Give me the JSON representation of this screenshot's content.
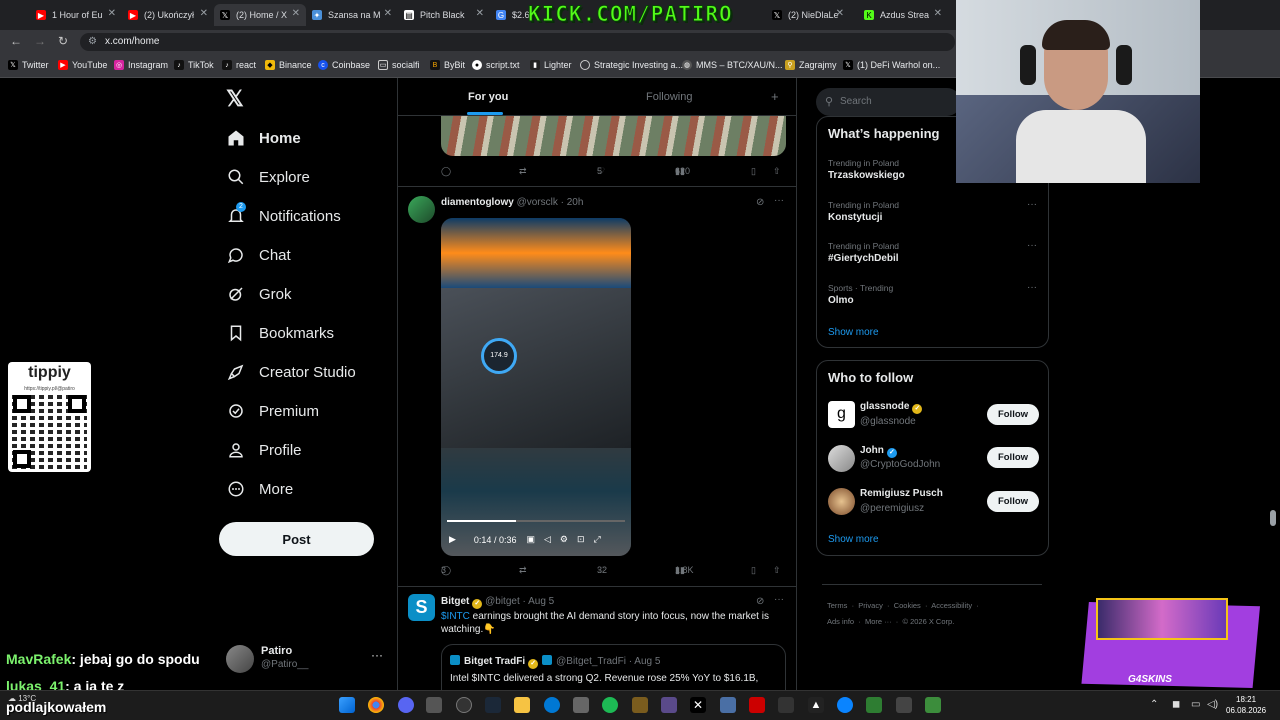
{
  "browser": {
    "tabs": [
      {
        "label": "1 Hour of Eu",
        "icon": "youtube-icon",
        "color": "#ff0000"
      },
      {
        "label": "(2) Ukończył",
        "icon": "youtube-icon",
        "color": "#ff0000"
      },
      {
        "label": "(2) Home / X",
        "icon": "x-icon",
        "color": "#000000"
      },
      {
        "label": "Szansa na M",
        "icon": "star-icon",
        "color": "#4a90d9"
      },
      {
        "label": "Pitch Black",
        "icon": "doc-icon",
        "color": "#ffffff"
      },
      {
        "label": "$2.6",
        "icon": "google-icon",
        "color": "#4285f4"
      },
      {
        "label": "(2) NieDlaLe",
        "icon": "x-icon",
        "color": "#000000"
      },
      {
        "label": "Azdus Strea",
        "icon": "kick-icon",
        "color": "#53fc18"
      }
    ],
    "url": "x.com/home",
    "bookmarks": [
      {
        "label": "Twitter",
        "icon": "x-icon"
      },
      {
        "label": "YouTube",
        "icon": "youtube-icon"
      },
      {
        "label": "Instagram",
        "icon": "instagram-icon"
      },
      {
        "label": "TikTok",
        "icon": "tiktok-icon"
      },
      {
        "label": "react",
        "icon": "tiktok-icon"
      },
      {
        "label": "Binance",
        "icon": "binance-icon"
      },
      {
        "label": "Coinbase",
        "icon": "coinbase-icon"
      },
      {
        "label": "socialfi",
        "icon": "folder-icon"
      },
      {
        "label": "ByBit",
        "icon": "bybit-icon"
      },
      {
        "label": "script.txt",
        "icon": "github-icon"
      },
      {
        "label": "Lighter",
        "icon": "lighter-icon"
      },
      {
        "label": "Strategic Investing a...",
        "icon": "circle-icon"
      },
      {
        "label": "MMS – BTC/XAU/N...",
        "icon": "globe-icon"
      },
      {
        "label": "Zagrajmy",
        "icon": "pin-icon"
      },
      {
        "label": "(1) DeFi Warhol on...",
        "icon": "x-icon"
      }
    ]
  },
  "overlays": {
    "kick_text": "KICK.COM/PATIRO",
    "tippy_title": "tippiy",
    "tippy_url": "https://tippiy.pl/@patiro",
    "chat": [
      {
        "user": "MavRafek",
        "message": ": jebaj go do spodu"
      },
      {
        "user": "lukas_41",
        "message": ": a ja te z"
      },
      {
        "user": "",
        "message": "podlajkowałem"
      }
    ],
    "skins_label": "G4SKINS"
  },
  "sidebar": {
    "items": [
      {
        "label": "Home",
        "icon": "home-icon",
        "active": true
      },
      {
        "label": "Explore",
        "icon": "search-icon"
      },
      {
        "label": "Notifications",
        "icon": "bell-icon",
        "badge": "2"
      },
      {
        "label": "Chat",
        "icon": "chat-icon"
      },
      {
        "label": "Grok",
        "icon": "grok-icon"
      },
      {
        "label": "Bookmarks",
        "icon": "bookmark-icon"
      },
      {
        "label": "Creator Studio",
        "icon": "rocket-icon"
      },
      {
        "label": "Premium",
        "icon": "premium-icon"
      },
      {
        "label": "Profile",
        "icon": "person-icon"
      },
      {
        "label": "More",
        "icon": "more-circle-icon"
      }
    ],
    "post_label": "Post",
    "profile": {
      "name": "Patiro",
      "handle": "@Patiro__"
    }
  },
  "feed": {
    "tabs": [
      "For you",
      "Following"
    ],
    "tweet1": {
      "replies": "",
      "retweets": "",
      "likes": "5",
      "views": "620"
    },
    "tweet2": {
      "name": "diamentoglowy",
      "handle": "@vorsclk",
      "time": "20h",
      "video_time": "0:14 / 0:36",
      "video_knob": "174.9",
      "video_progress": 0.39,
      "replies": "3",
      "retweets": "",
      "likes": "32",
      "views": "1.8K"
    },
    "tweet3": {
      "name": "Bitget",
      "handle": "@bitget",
      "time": "Aug 5",
      "cashtag": "$INTC",
      "text": " earnings brought the AI demand story into focus, now the market is watching.",
      "emoji": "👇",
      "quote_name": "Bitget TradFi",
      "quote_handle": "@Bitget_TradFi",
      "quote_time": "Aug 5",
      "quote_text": "Intel $INTC delivered a strong Q2. Revenue rose 25% YoY to $16.1B,"
    }
  },
  "right": {
    "search_placeholder": "Search",
    "happening_title": "What’s happening",
    "trends": [
      {
        "sub": "Trending in Poland",
        "main": "Trzaskowskiego"
      },
      {
        "sub": "Trending in Poland",
        "main": "Konstytucji"
      },
      {
        "sub": "Trending in Poland",
        "main": "#GiertychDebil"
      },
      {
        "sub": "Sports · Trending",
        "main": "Olmo"
      }
    ],
    "show_more": "Show more",
    "wtf_title": "Who to follow",
    "wtf": [
      {
        "name": "glassnode",
        "handle": "@glassnode",
        "badge": "gold",
        "avatar": "g"
      },
      {
        "name": "John",
        "handle": "@CryptoGodJohn",
        "badge": "blue",
        "avatar": ""
      },
      {
        "name": "Remigiusz Pusch",
        "handle": "@peremigiusz",
        "badge": "",
        "avatar": ""
      }
    ],
    "follow_label": "Follow",
    "footer": [
      "Terms",
      "Privacy",
      "Cookies",
      "Accessibility",
      "Ads info",
      "More ···",
      "© 2026 X Corp."
    ]
  },
  "taskbar": {
    "weather": "13°C",
    "time": "18:21",
    "date": "06.08.2026"
  }
}
